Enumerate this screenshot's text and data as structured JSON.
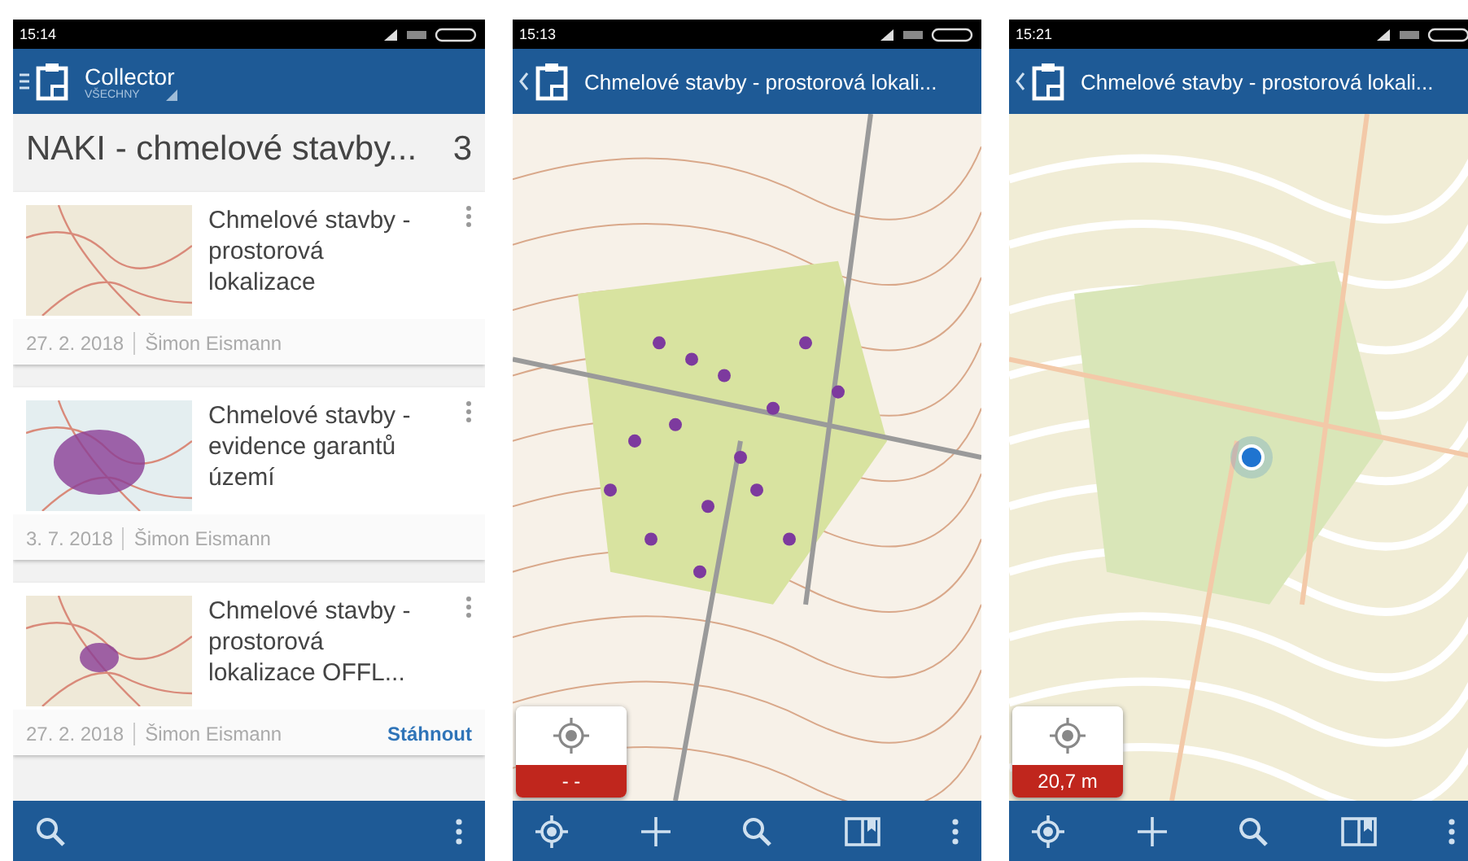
{
  "phones": [
    {
      "kind": "list",
      "status_time": "15:14",
      "app_bar": {
        "title": "Collector",
        "subtitle": "VŠECHNY"
      },
      "heading": "NAKI - chmelové stavby...",
      "count": "3",
      "maps": [
        {
          "title": "Chmelové stavby - prostorová lokalizace",
          "date": "27. 2. 2018",
          "author": "Šimon Eismann"
        },
        {
          "title": "Chmelové stavby - evidence garantů území",
          "date": "3. 7. 2018",
          "author": "Šimon Eismann"
        },
        {
          "title": "Chmelové stavby - prostorová lokalizace OFFL...",
          "date": "27. 2. 2018",
          "author": "Šimon Eismann",
          "action": "Stáhnout"
        }
      ]
    },
    {
      "kind": "topo_map",
      "status_time": "15:13",
      "app_bar": {
        "title": "Chmelové stavby - prostorová lokali..."
      },
      "accuracy": "- -",
      "location_dot": false
    },
    {
      "kind": "street_map",
      "status_time": "15:21",
      "app_bar": {
        "title": "Chmelové stavby - prostorová lokali..."
      },
      "accuracy": "20,7 m",
      "location_dot": true
    }
  ]
}
